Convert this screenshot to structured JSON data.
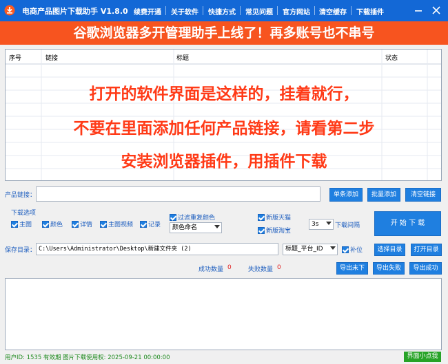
{
  "window": {
    "title": "电商产品图片下载助手 V1.8.0",
    "menu": [
      "续费开通",
      "关于软件",
      "快捷方式",
      "常见问题",
      "官方网站",
      "清空缓存",
      "下载插件"
    ]
  },
  "banner": {
    "text": "谷歌浏览器多开管理助手上线了！再多账号也不串号"
  },
  "table": {
    "columns": [
      "序号",
      "链接",
      "标题",
      "状态"
    ],
    "overlay": [
      "打开的软件界面是这样的，挂着就行，",
      "不要在里面添加任何产品链接，请看第二步",
      "安装浏览器插件，用插件下载"
    ]
  },
  "product": {
    "label": "产品链接：",
    "value": "",
    "buttons": {
      "single": "单条添加",
      "batch": "批量添加",
      "clear": "清空链接"
    }
  },
  "options": {
    "title": "下载选项",
    "checkboxes": [
      "主图",
      "颜色",
      "详情",
      "主图视频",
      "记录"
    ],
    "filter_dup": "过滤重复颜色",
    "color_naming": "颜色命名",
    "new_tmall": "新版天猫",
    "new_taobao": "新版淘宝",
    "interval_value": "3s",
    "interval_label": "下载间隔",
    "start": "开 始 下 载"
  },
  "save": {
    "label": "保存目录：",
    "path": "C:\\Users\\Administrator\\Desktop\\新建文件夹 (2)",
    "naming": "标题_平台_ID",
    "pad": "补位",
    "choose": "选择目录",
    "open": "打开目录"
  },
  "stats": {
    "success_label": "成功数量",
    "success_value": "0",
    "fail_label": "失败数量",
    "fail_value": "0",
    "export_pending": "导出未下",
    "export_fail": "导出失败",
    "export_success": "导出成功"
  },
  "status": {
    "text": "用户ID: 1535 有效期 图片下载使用权: 2025-09-21 00:00:00",
    "mini": "界面小点我"
  },
  "colors": {
    "titlebar": "#1368d6",
    "banner": "#f7541f",
    "overlay": "#ff3a17",
    "accent": "#1f7fe0",
    "status_green": "#1e8a1e"
  }
}
